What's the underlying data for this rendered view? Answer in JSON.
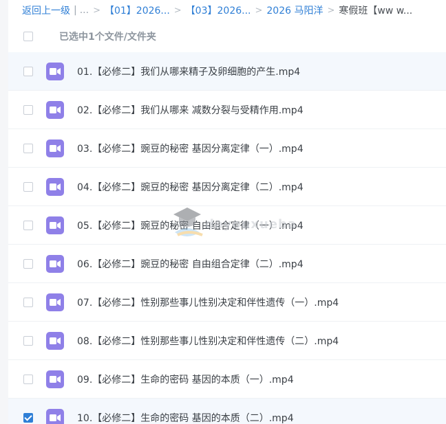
{
  "breadcrumb": {
    "back_label": "返回上一级",
    "sep_bar": "|",
    "ellipsis": "...",
    "sep": ">",
    "items": [
      "【01】2026...",
      "【03】2026...",
      "2026 马阳洋"
    ],
    "current": "寒假班【ww w..."
  },
  "selection": {
    "label": "已选中1个文件/文件夹"
  },
  "files": [
    {
      "name": "01.【必修二】我们从哪来精子及卵细胞的产生.mp4",
      "checked": false,
      "highlight": true
    },
    {
      "name": "02.【必修二】我们从哪来 减数分裂与受精作用.mp4",
      "checked": false,
      "highlight": false
    },
    {
      "name": "03.【必修二】豌豆的秘密 基因分离定律（一）.mp4",
      "checked": false,
      "highlight": false
    },
    {
      "name": "04.【必修二】豌豆的秘密 基因分离定律（二）.mp4",
      "checked": false,
      "highlight": false
    },
    {
      "name": "05.【必修二】豌豆的秘密 自由组合定律（一）.mp4",
      "checked": false,
      "highlight": false
    },
    {
      "name": "06.【必修二】豌豆的秘密 自由组合定律（二）.mp4",
      "checked": false,
      "highlight": false
    },
    {
      "name": "07.【必修二】性别那些事儿性别决定和伴性遗传（一）.mp4",
      "checked": false,
      "highlight": false
    },
    {
      "name": "08.【必修二】性别那些事儿性别决定和伴性遗传（二）.mp4",
      "checked": false,
      "highlight": false
    },
    {
      "name": "09.【必修二】生命的密码 基因的本质（一）.mp4",
      "checked": false,
      "highlight": false
    },
    {
      "name": "10.【必修二】生命的密码 基因的本质（二）.mp4",
      "checked": true,
      "highlight": true
    }
  ],
  "watermark": {
    "text": "dayouxueba"
  },
  "colors": {
    "accent": "#2f7fd6",
    "video_icon": "#8f80e8"
  }
}
